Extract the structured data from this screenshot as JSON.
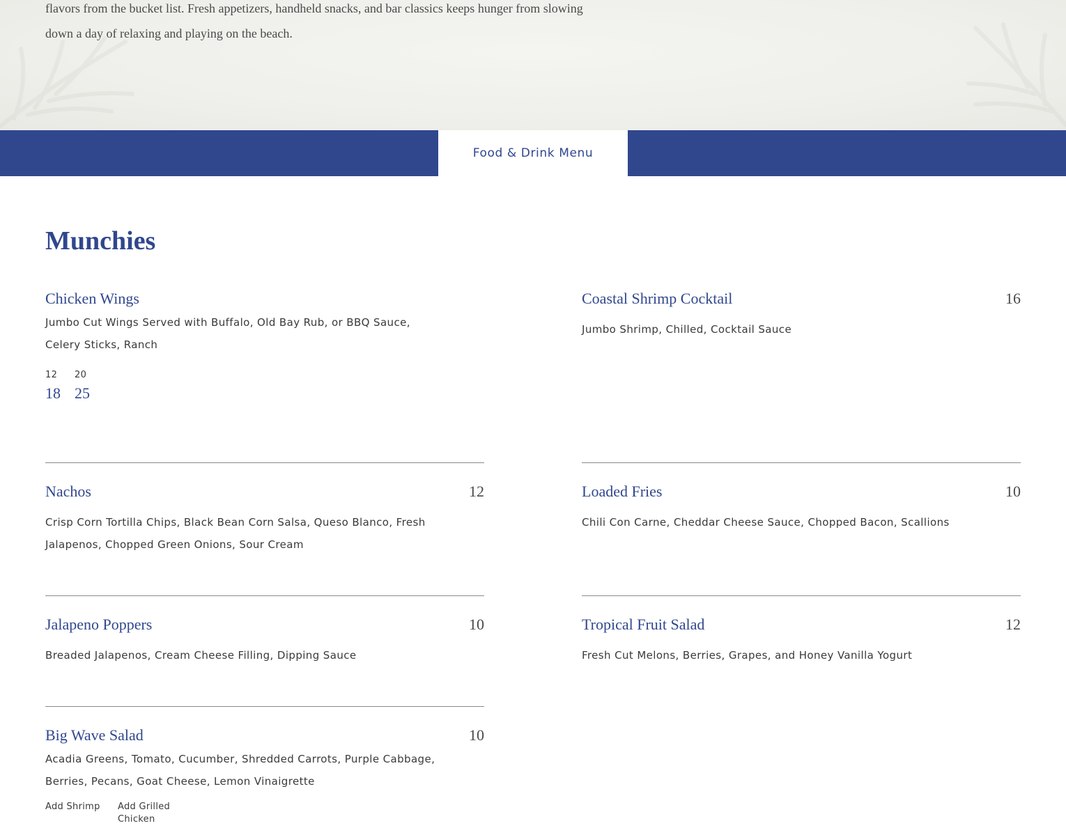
{
  "hero": {
    "text": "flavors from the bucket list. Fresh appetizers, handheld snacks, and bar classics keeps hunger from slowing down a day of relaxing and playing on the beach."
  },
  "tabs": {
    "active_label": "Food & Drink Menu"
  },
  "section": {
    "title": "Munchies"
  },
  "items": {
    "chicken_wings": {
      "name": "Chicken Wings",
      "desc": "Jumbo Cut Wings Served with Buffalo, Old Bay Rub, or BBQ Sauce, Celery Sticks, Ranch",
      "sizes": [
        {
          "label": "12",
          "price": "18"
        },
        {
          "label": "20",
          "price": "25"
        }
      ]
    },
    "shrimp_cocktail": {
      "name": "Coastal Shrimp Cocktail",
      "price": "16",
      "desc": "Jumbo Shrimp, Chilled, Cocktail Sauce"
    },
    "nachos": {
      "name": "Nachos",
      "price": "12",
      "desc": "Crisp Corn Tortilla Chips, Black Bean Corn Salsa, Queso Blanco, Fresh Jalapenos, Chopped Green Onions, Sour Cream"
    },
    "loaded_fries": {
      "name": "Loaded Fries",
      "price": "10",
      "desc": "Chili Con Carne, Cheddar Cheese Sauce, Chopped Bacon, Scallions"
    },
    "jalapeno_poppers": {
      "name": "Jalapeno Poppers",
      "price": "10",
      "desc": "Breaded Jalapenos, Cream Cheese Filling, Dipping Sauce"
    },
    "fruit_salad": {
      "name": "Tropical Fruit Salad",
      "price": "12",
      "desc": "Fresh Cut Melons, Berries, Grapes, and Honey Vanilla Yogurt"
    },
    "big_wave_salad": {
      "name": "Big Wave Salad",
      "price": "10",
      "desc": "Acadia Greens, Tomato, Cucumber, Shredded Carrots, Purple Cabbage, Berries, Pecans, Goat Cheese, Lemon Vinaigrette",
      "addons": [
        "Add Shrimp",
        "Add Grilled Chicken"
      ]
    }
  },
  "colors": {
    "brand_blue": "#30478e",
    "divider": "#8a8a8a",
    "hero_bg": "#efefeb"
  }
}
